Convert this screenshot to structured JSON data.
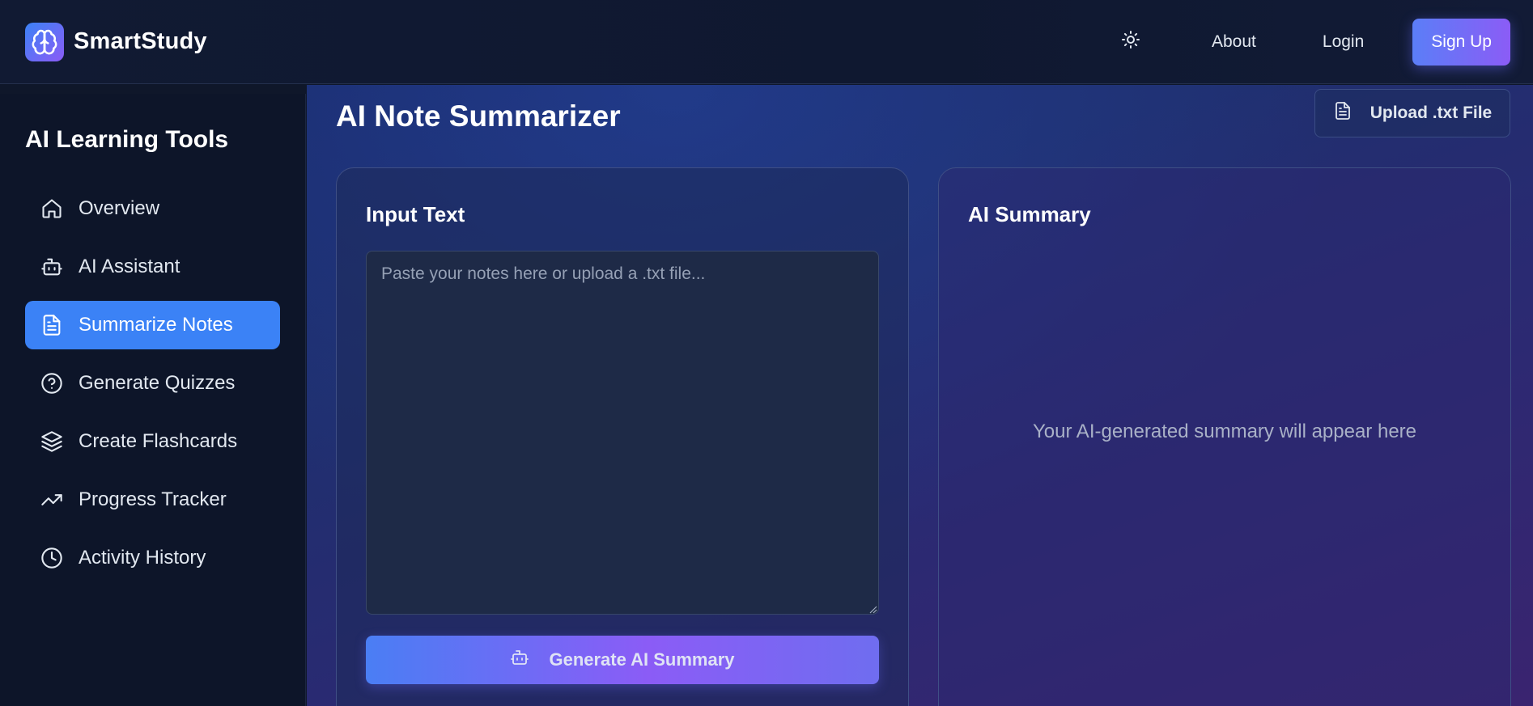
{
  "header": {
    "brand": "SmartStudy",
    "logo_icon": "brain-icon",
    "theme_icon": "sun-icon",
    "nav": {
      "about": "About",
      "login": "Login",
      "signup": "Sign Up"
    }
  },
  "sidebar": {
    "title": "AI Learning Tools",
    "items": [
      {
        "label": "Overview",
        "icon": "home-icon",
        "active": false
      },
      {
        "label": "AI Assistant",
        "icon": "bot-icon",
        "active": false
      },
      {
        "label": "Summarize Notes",
        "icon": "file-text-icon",
        "active": true
      },
      {
        "label": "Generate Quizzes",
        "icon": "help-circle-icon",
        "active": false
      },
      {
        "label": "Create Flashcards",
        "icon": "layers-icon",
        "active": false
      },
      {
        "label": "Progress Tracker",
        "icon": "trending-up-icon",
        "active": false
      },
      {
        "label": "Activity History",
        "icon": "clock-icon",
        "active": false
      }
    ]
  },
  "main": {
    "title": "AI Note Summarizer",
    "upload_label": "Upload .txt File",
    "input_card": {
      "title": "Input Text",
      "placeholder": "Paste your notes here or upload a .txt file...",
      "value": "",
      "button_label": "Generate AI Summary"
    },
    "summary_card": {
      "title": "AI Summary",
      "placeholder": "Your AI-generated summary will appear here"
    }
  },
  "colors": {
    "accent": "#3b82f6",
    "accent_purple": "#8b5cf6",
    "background": "#0f172a"
  }
}
